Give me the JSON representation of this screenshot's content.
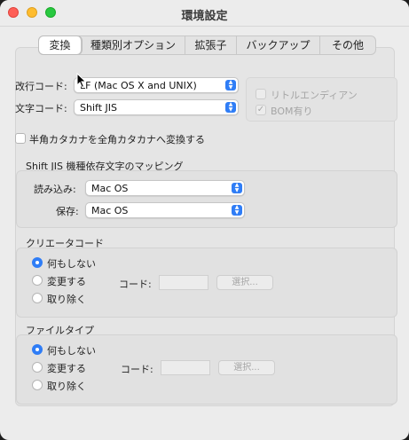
{
  "window": {
    "title": "環境設定"
  },
  "tabs": [
    {
      "label": "変換",
      "active": true
    },
    {
      "label": "種類別オプション",
      "active": false
    },
    {
      "label": "拡張子",
      "active": false
    },
    {
      "label": "バックアップ",
      "active": false
    },
    {
      "label": "その他",
      "active": false
    }
  ],
  "encoding": {
    "newline_label": "改行コード:",
    "newline_value": "LF (Mac OS X and UNIX)",
    "charset_label": "文字コード:",
    "charset_value": "Shift JIS",
    "little_endian_label": "リトルエンディアン",
    "little_endian_checked": false,
    "bom_label": "BOM有り",
    "bom_checked": true
  },
  "hankaku": {
    "label": "半角カタカナを全角カタカナへ変換する",
    "checked": false
  },
  "mapping": {
    "title": "Shift JIS 機種依存文字のマッピング",
    "read_label": "読み込み:",
    "read_value": "Mac OS",
    "save_label": "保存:",
    "save_value": "Mac OS"
  },
  "creator": {
    "title": "クリエータコード",
    "options": [
      "何もしない",
      "変更する",
      "取り除く"
    ],
    "selected": 0,
    "code_label": "コード:",
    "code_value": "",
    "select_button": "選択..."
  },
  "filetype": {
    "title": "ファイルタイプ",
    "options": [
      "何もしない",
      "変更する",
      "取り除く"
    ],
    "selected": 0,
    "code_label": "コード:",
    "code_value": "",
    "select_button": "選択..."
  },
  "icons": {
    "stepper": "up-down-chevron-icon",
    "check": "checkmark-icon",
    "cursor": "mouse-pointer-icon"
  },
  "colors": {
    "accent": "#2f7df6",
    "close": "#fe5f57",
    "minimize": "#febc2e",
    "maximize": "#28c840"
  }
}
